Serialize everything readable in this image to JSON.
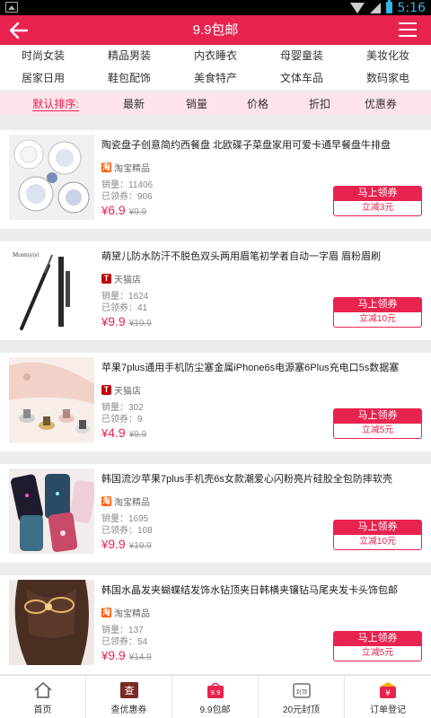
{
  "status": {
    "time": "5:16"
  },
  "header": {
    "title": "9.9包邮"
  },
  "categories": [
    {
      "label": "时尚女装"
    },
    {
      "label": "精品男装"
    },
    {
      "label": "内衣睡衣"
    },
    {
      "label": "母婴童装"
    },
    {
      "label": "美妆化妆"
    },
    {
      "label": "居家日用"
    },
    {
      "label": "鞋包配饰"
    },
    {
      "label": "美食特产"
    },
    {
      "label": "文体车品"
    },
    {
      "label": "数码家电"
    }
  ],
  "sort": [
    {
      "label": "默认排序:"
    },
    {
      "label": "最新"
    },
    {
      "label": "销量"
    },
    {
      "label": "价格"
    },
    {
      "label": "折扣"
    },
    {
      "label": "优惠券"
    }
  ],
  "products": [
    {
      "title": "陶瓷盘子创意简约西餐盘 北欧碟子菜盘家用可爱卡通早餐盘牛排盘",
      "shop": "淘宝精品",
      "shop_type": "taobao",
      "shop_icon": "淘",
      "sales": "销量：11406",
      "claimed": "已领券：906",
      "currency": "¥",
      "price": "6.9",
      "orig_price": "¥9.9",
      "coupon_btn": "马上领券",
      "coupon_off": "立减3元"
    },
    {
      "title": "萌黛儿防水防汗不脱色双头两用眉笔初学者自动一字眉 眉粉眉刷",
      "shop": "天猫店",
      "shop_type": "tmall",
      "shop_icon": "T",
      "sales": "销量：1624",
      "claimed": "已领券：41",
      "currency": "¥",
      "price": "9.9",
      "orig_price": "¥19.9",
      "coupon_btn": "马上领券",
      "coupon_off": "立减10元",
      "thumb_text": "Montuyiyi"
    },
    {
      "title": "苹果7plus通用手机防尘塞金属iPhone6s电源塞6Plus充电口5s数据塞",
      "shop": "天猫店",
      "shop_type": "tmall",
      "shop_icon": "T",
      "sales": "销量：302",
      "claimed": "已领券：9",
      "currency": "¥",
      "price": "4.9",
      "orig_price": "¥9.9",
      "coupon_btn": "马上领券",
      "coupon_off": "立减5元"
    },
    {
      "title": "韩国流沙苹果7plus手机壳6s女款潮爱心闪粉亮片硅胶全包防摔软壳",
      "shop": "淘宝精品",
      "shop_type": "taobao",
      "shop_icon": "淘",
      "sales": "销量：1695",
      "claimed": "已领券：108",
      "currency": "¥",
      "price": "9.9",
      "orig_price": "¥19.9",
      "coupon_btn": "马上领券",
      "coupon_off": "立减10元"
    },
    {
      "title": "韩国水晶发夹蝴蝶结发饰水钻顶夹日韩横夹镶钻马尾夹发卡头饰包邮",
      "shop": "淘宝精品",
      "shop_type": "taobao",
      "shop_icon": "淘",
      "sales": "销量：137",
      "claimed": "已领券：54",
      "currency": "¥",
      "price": "9.9",
      "orig_price": "¥14.9",
      "coupon_btn": "马上领券",
      "coupon_off": "立减5元"
    }
  ],
  "bottom_nav": [
    {
      "label": "首页",
      "icon": "home-icon"
    },
    {
      "label": "查优惠券",
      "icon": "coupon-search-icon",
      "icon_text": "查"
    },
    {
      "label": "9.9包邮",
      "icon": "shopping-bag-icon",
      "icon_text": "9.9"
    },
    {
      "label": "20元封顶",
      "icon": "price-cap-icon",
      "icon_text": "封顶"
    },
    {
      "label": "订单登记",
      "icon": "order-register-icon",
      "icon_text": "¥"
    }
  ],
  "colors": {
    "accent": "#e8234f",
    "sort_bg": "#fde4ea",
    "taobao": "#ff5a00",
    "tmall": "#c40000"
  }
}
